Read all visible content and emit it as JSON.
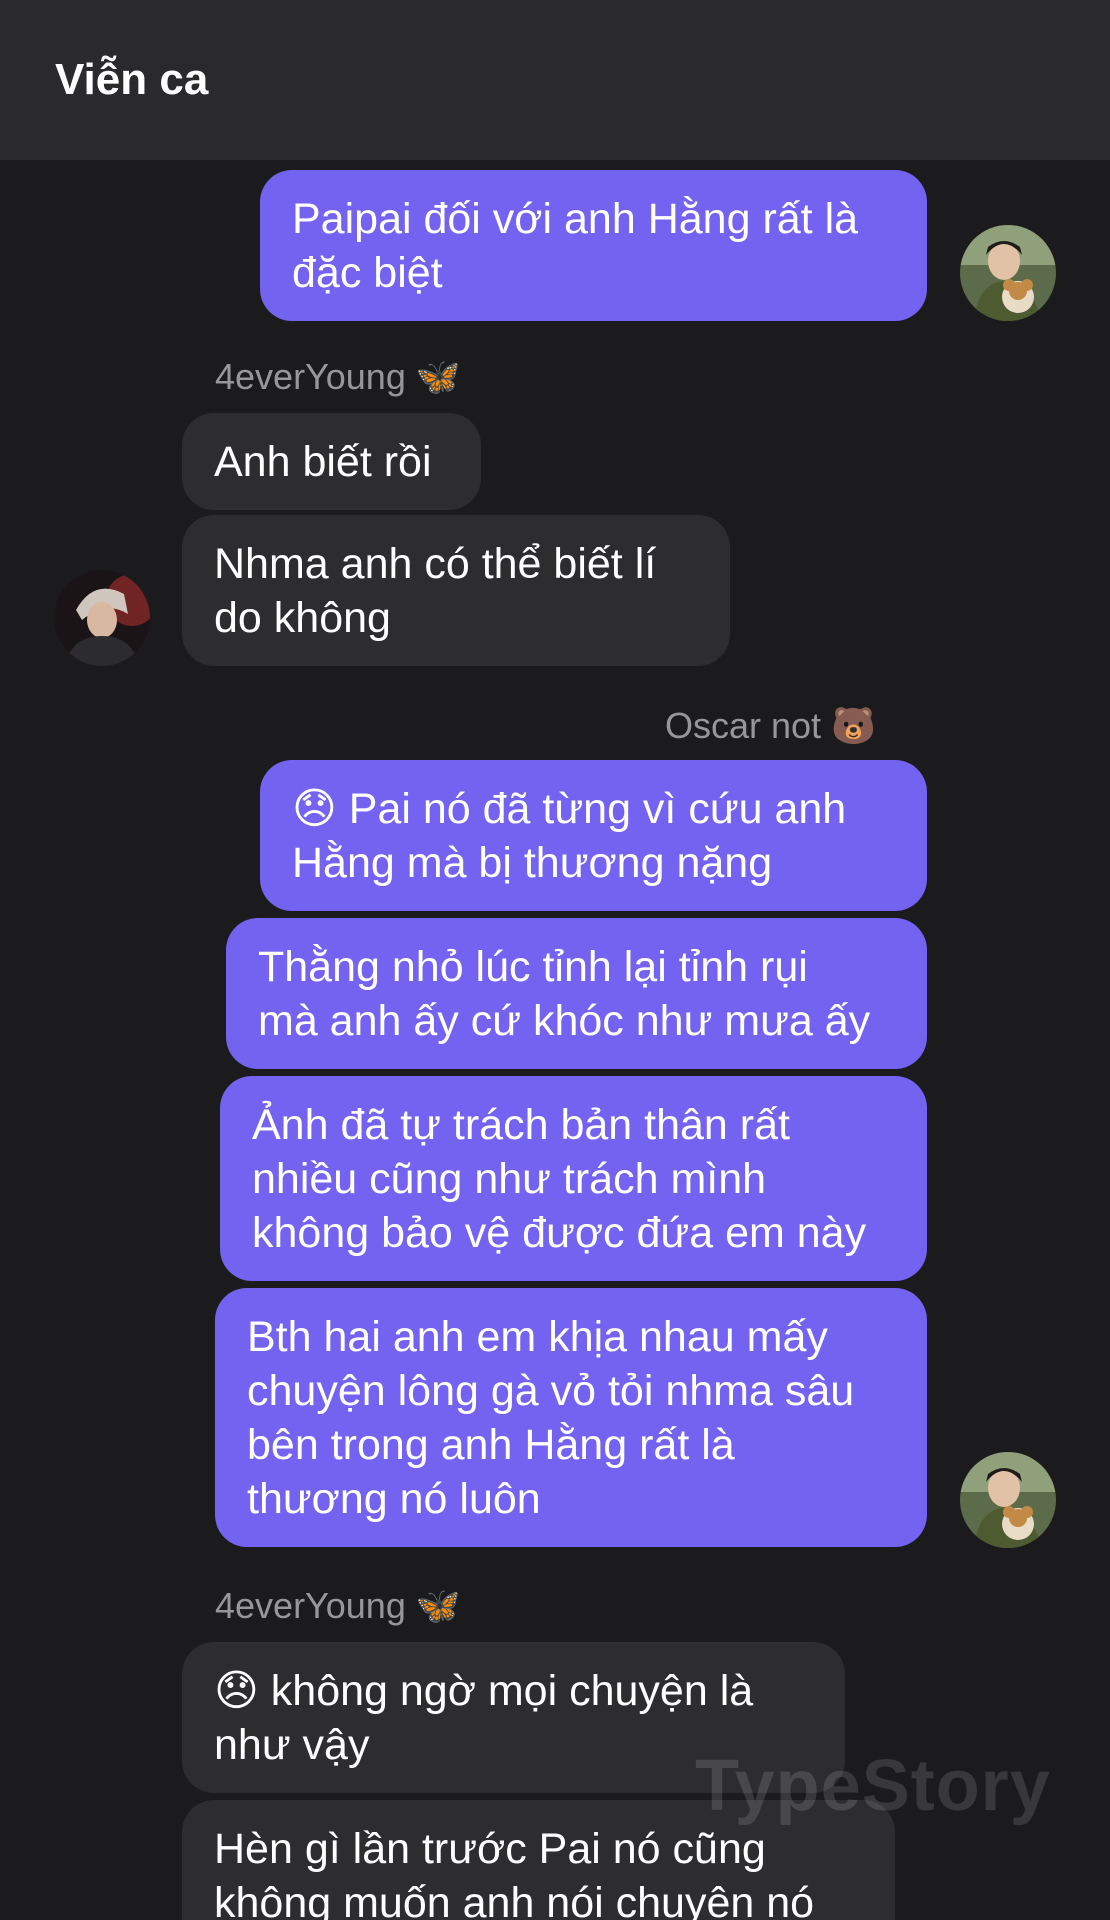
{
  "header": {
    "title": "Viễn ca"
  },
  "senders": {
    "left": "4everYoung 🦋",
    "right": "Oscar not 🐻"
  },
  "messages": [
    "Paipai đối với anh Hằng rất là\nđặc biệt",
    "Anh biết rồi",
    "Nhma anh có thể biết lí\ndo không",
    "😞 Pai nó đã từng vì cứu anh\nHằng mà bị thương nặng",
    "Thằng nhỏ lúc tỉnh lại tỉnh rụi\nmà anh ấy cứ khóc như mưa ấy",
    "Ảnh đã tự trách bản thân rất\nnhiều cũng như trách mình\nkhông bảo vệ được đứa em này",
    "Bth hai anh em khịa nhau mấy\nchuyện lông gà vỏ tỏi nhma sâu\nbên trong anh Hằng rất là\nthương nó luôn",
    "😞 không ngờ mọi chuyện là\nnhư vậy",
    "Hèn gì lần trước Pai nó cũng\nkhông muốn anh nói chuyện nó"
  ],
  "watermark": "TypeStory",
  "colors": {
    "background": "#1b1b1d",
    "header": "#2a2a2c",
    "outgoing_bubble": "#7462f1",
    "incoming_bubble": "#2d2d30"
  }
}
